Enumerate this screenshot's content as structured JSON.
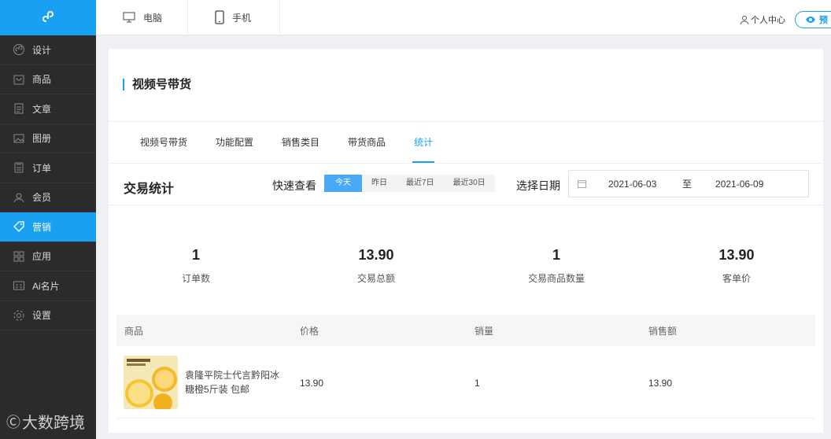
{
  "sidebar": {
    "items": [
      {
        "label": "设计",
        "icon": "design-icon"
      },
      {
        "label": "商品",
        "icon": "bag-icon"
      },
      {
        "label": "文章",
        "icon": "article-icon"
      },
      {
        "label": "图册",
        "icon": "album-icon"
      },
      {
        "label": "订单",
        "icon": "order-icon"
      },
      {
        "label": "会员",
        "icon": "user-icon"
      },
      {
        "label": "营销",
        "icon": "tag-icon",
        "active": true
      },
      {
        "label": "应用",
        "icon": "apps-icon"
      },
      {
        "label": "Ai名片",
        "icon": "card-icon"
      },
      {
        "label": "设置",
        "icon": "gear-icon"
      }
    ],
    "watermark": "大数跨境",
    "watermark_logo": "Ⓒ"
  },
  "topbar": {
    "device_tabs": [
      "电脑",
      "手机"
    ],
    "user_center": "个人中心",
    "preview_label": "预"
  },
  "page": {
    "title": "视频号带货",
    "tabs": [
      "视频号带货",
      "功能配置",
      "销售类目",
      "带货商品",
      "统计"
    ],
    "active_tab": "统计"
  },
  "stats": {
    "title": "交易统计",
    "quick_label": "快速查看",
    "quick_options": [
      "今天",
      "昨日",
      "最近7日",
      "最近30日"
    ],
    "active_quick": "今天",
    "date_label": "选择日期",
    "date_start": "2021-06-03",
    "date_sep": "至",
    "date_end": "2021-06-09",
    "metrics": [
      {
        "value": "1",
        "label": "订单数"
      },
      {
        "value": "13.90",
        "label": "交易总额"
      },
      {
        "value": "1",
        "label": "交易商品数量"
      },
      {
        "value": "13.90",
        "label": "客单价"
      }
    ]
  },
  "table": {
    "headers": [
      "商品",
      "价格",
      "销量",
      "销售额"
    ],
    "rows": [
      {
        "product": "袁隆平院士代言黔阳冰糖橙5斤装 包邮",
        "price": "13.90",
        "sales": "1",
        "amount": "13.90"
      }
    ]
  },
  "colors": {
    "accent": "#1aa0f0",
    "sidebar_bg": "#2b2b2b"
  }
}
